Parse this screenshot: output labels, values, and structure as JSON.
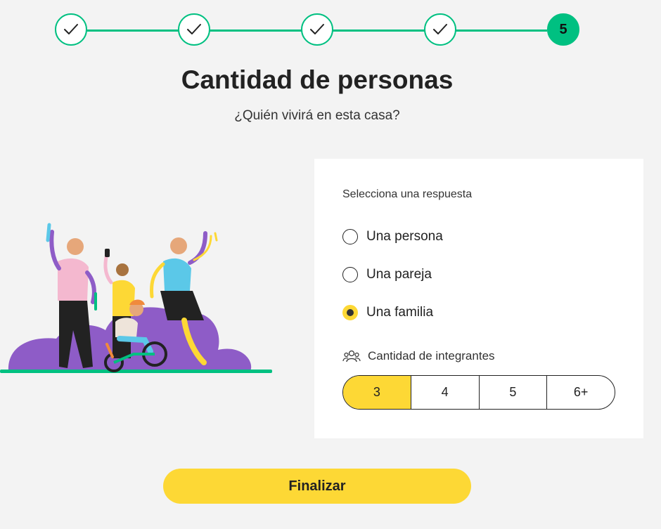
{
  "stepper": {
    "steps": [
      {
        "state": "done",
        "icon": "check-icon"
      },
      {
        "state": "done",
        "icon": "check-icon"
      },
      {
        "state": "done",
        "icon": "check-icon"
      },
      {
        "state": "done",
        "icon": "check-icon"
      },
      {
        "state": "current",
        "label": "5"
      }
    ],
    "accent_color": "#00c081"
  },
  "header": {
    "title": "Cantidad de personas",
    "subtitle": "¿Quién vivirá en esta casa?"
  },
  "form": {
    "prompt": "Selecciona una respuesta",
    "options": [
      {
        "label": "Una persona",
        "selected": false
      },
      {
        "label": "Una pareja",
        "selected": false
      },
      {
        "label": "Una familia",
        "selected": true
      }
    ],
    "members": {
      "label": "Cantidad de integrantes",
      "icon": "people-icon",
      "choices": [
        "3",
        "4",
        "5",
        "6+"
      ],
      "selected": "3"
    }
  },
  "actions": {
    "finish_label": "Finalizar",
    "button_color": "#fdd835"
  }
}
